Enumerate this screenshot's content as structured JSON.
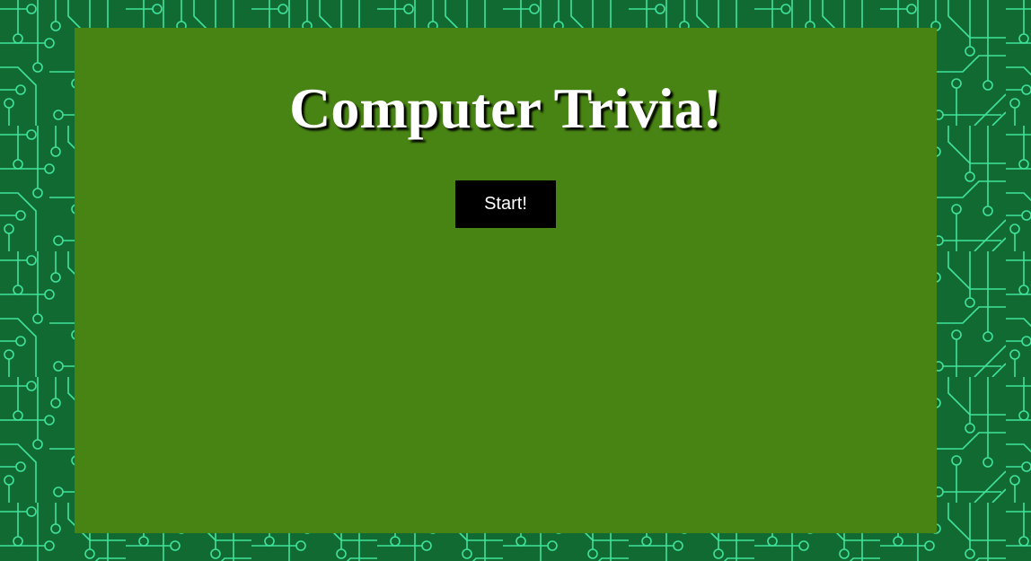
{
  "page": {
    "title": "Computer Trivia!"
  },
  "controls": {
    "start_label": "Start!"
  },
  "colors": {
    "background": "#126a33",
    "circuit_trace": "#3fe39b",
    "panel": "#488413",
    "button": "#000000",
    "text": "#ffffff"
  },
  "icons": {
    "background": "circuit-board-pattern"
  }
}
